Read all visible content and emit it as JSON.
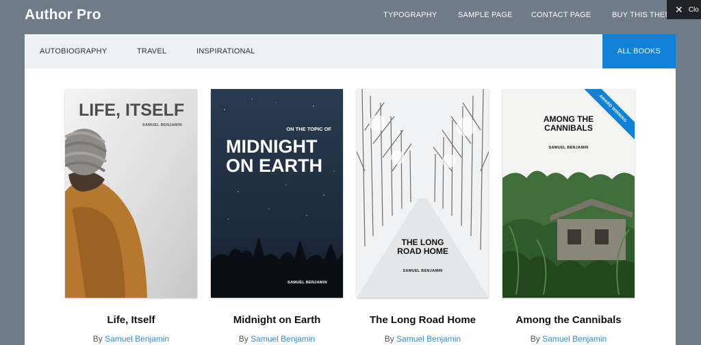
{
  "header": {
    "site_title": "Author Pro",
    "nav": [
      "TYPOGRAPHY",
      "SAMPLE PAGE",
      "CONTACT PAGE",
      "BUY THIS THEME"
    ],
    "close_label": "Clo"
  },
  "filters": {
    "items": [
      "AUTOBIOGRAPHY",
      "TRAVEL",
      "INSPIRATIONAL"
    ],
    "active": "ALL BOOKS"
  },
  "books": [
    {
      "title": "Life, Itself",
      "by": "By",
      "author": "Samuel Benjamin",
      "cover_title": "LIFE, ITSELF",
      "cover_author": "SAMUEL BENJAMIN"
    },
    {
      "title": "Midnight on Earth",
      "by": "By",
      "author": "Samuel Benjamin",
      "cover_pretitle": "ON THE TOPIC OF",
      "cover_title": "MIDNIGHT\nON EARTH",
      "cover_author": "SAMUEL BENJAMIN"
    },
    {
      "title": "The Long Road Home",
      "by": "By",
      "author": "Samuel Benjamin",
      "cover_title": "THE LONG\nROAD HOME",
      "cover_author": "SAMUEL BENJAMIN"
    },
    {
      "title": "Among the Cannibals",
      "by": "By",
      "author": "Samuel Benjamin",
      "cover_title": "AMONG THE\nCANNIBALS",
      "cover_author": "SAMUEL BENJAMIN",
      "ribbon": "AWARD WINNING"
    }
  ],
  "colors": {
    "background": "#6f7c88",
    "accent": "#0f82d8",
    "link": "#2f8fe0"
  }
}
